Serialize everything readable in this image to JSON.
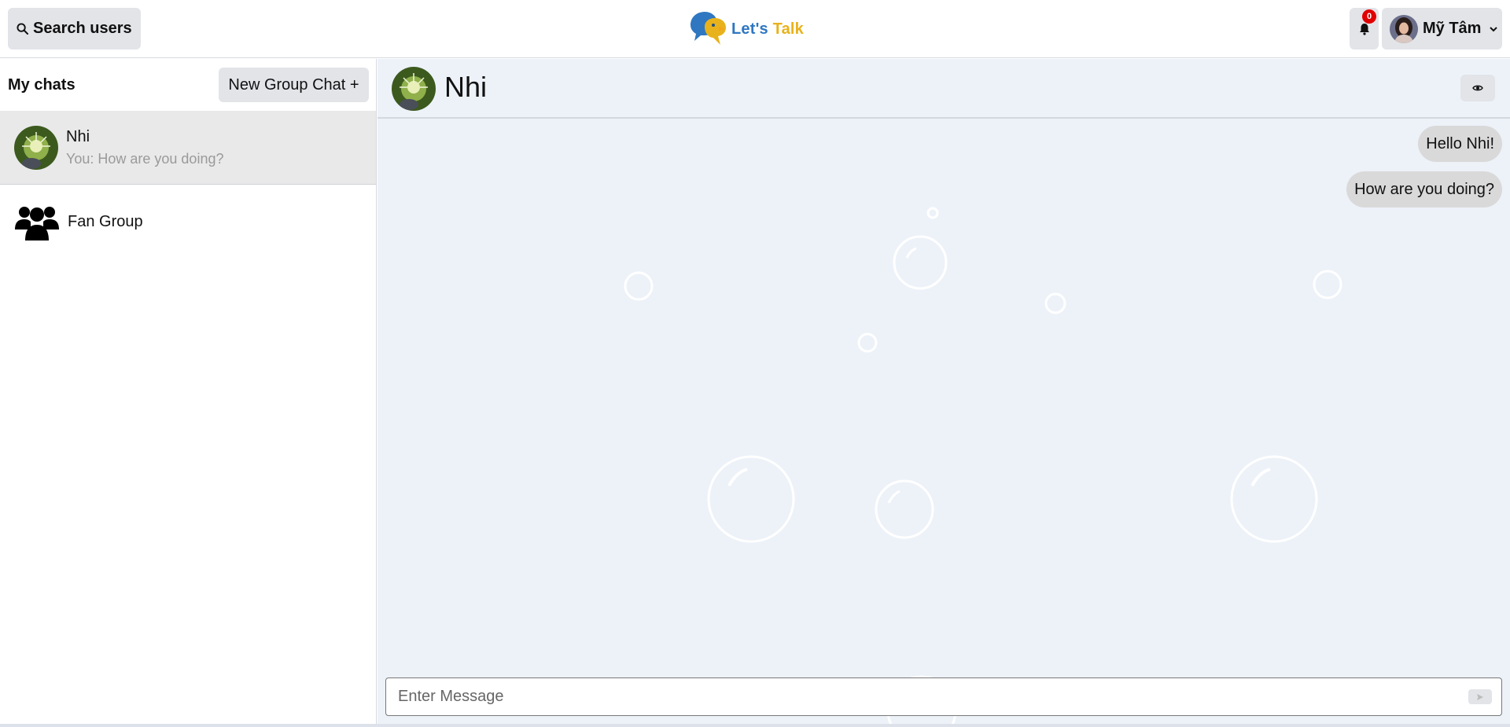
{
  "header": {
    "search_label": "Search users",
    "search_icon": "search-icon",
    "logo_part1": "Let's",
    "logo_part2": " Talk",
    "notification_count": "0",
    "user_name": "Mỹ Tâm"
  },
  "sidebar": {
    "title": "My chats",
    "new_group_label": "New Group Chat +",
    "chats": [
      {
        "name": "Nhi",
        "preview": "You: How are you doing?",
        "active": true
      },
      {
        "name": "Fan Group",
        "preview": "",
        "active": false
      }
    ]
  },
  "chat": {
    "title": "Nhi",
    "messages": [
      {
        "text": "Hello Nhi!",
        "from": "me"
      },
      {
        "text": "How are you doing?",
        "from": "me"
      }
    ],
    "input_placeholder": "Enter Message"
  },
  "colors": {
    "logo_blue": "#2f77c1",
    "logo_yellow": "#e8b21c",
    "chat_bg": "#edf2f9",
    "badge_red": "#e10000"
  }
}
